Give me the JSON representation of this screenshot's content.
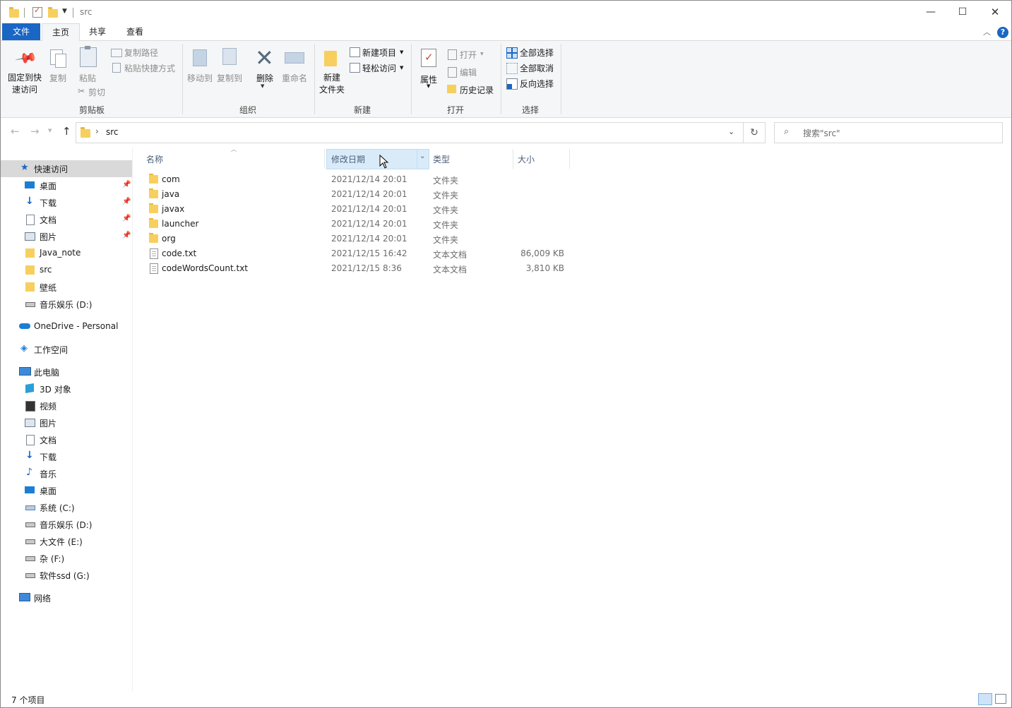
{
  "window": {
    "title": "src",
    "controls": {
      "minimize": "—",
      "maximize": "☐",
      "close": "✕"
    }
  },
  "ribbon_tabs": {
    "file": "文件",
    "home": "主页",
    "share": "共享",
    "view": "查看"
  },
  "ribbon": {
    "clipboard": {
      "pin": "固定到快\n速访问",
      "copy": "复制",
      "paste": "粘贴",
      "copy_path": "复制路径",
      "paste_shortcut": "粘贴快捷方式",
      "cut": "剪切",
      "label": "剪贴板"
    },
    "organize": {
      "move_to": "移动到",
      "copy_to": "复制到",
      "delete": "删除",
      "rename": "重命名",
      "label": "组织"
    },
    "new": {
      "new_folder": "新建\n文件夹",
      "new_item": "新建项目",
      "easy_access": "轻松访问",
      "label": "新建"
    },
    "open": {
      "properties": "属性",
      "open": "打开",
      "edit": "编辑",
      "history": "历史记录",
      "label": "打开"
    },
    "select": {
      "select_all": "全部选择",
      "select_none": "全部取消",
      "invert": "反向选择",
      "label": "选择"
    }
  },
  "address": {
    "crumb": "src",
    "refresh": "↻"
  },
  "search": {
    "placeholder": "搜索\"src\""
  },
  "nav": {
    "quick_access": "快速访问",
    "quick_items": [
      "桌面",
      "下载",
      "文档",
      "图片",
      "Java_note",
      "src",
      "壁纸",
      "音乐娱乐 (D:)"
    ],
    "onedrive": "OneDrive - Personal",
    "workspace": "工作空间",
    "this_pc": "此电脑",
    "pc_items": [
      "3D 对象",
      "视频",
      "图片",
      "文档",
      "下载",
      "音乐",
      "桌面",
      "系统 (C:)",
      "音乐娱乐 (D:)",
      "大文件 (E:)",
      "杂 (F:)",
      "软件ssd (G:)"
    ],
    "network": "网络"
  },
  "columns": {
    "name": "名称",
    "date": "修改日期",
    "type": "类型",
    "size": "大小"
  },
  "files": [
    {
      "name": "com",
      "date": "2021/12/14 20:01",
      "type": "文件夹",
      "size": "",
      "kind": "folder"
    },
    {
      "name": "java",
      "date": "2021/12/14 20:01",
      "type": "文件夹",
      "size": "",
      "kind": "folder"
    },
    {
      "name": "javax",
      "date": "2021/12/14 20:01",
      "type": "文件夹",
      "size": "",
      "kind": "folder"
    },
    {
      "name": "launcher",
      "date": "2021/12/14 20:01",
      "type": "文件夹",
      "size": "",
      "kind": "folder"
    },
    {
      "name": "org",
      "date": "2021/12/14 20:01",
      "type": "文件夹",
      "size": "",
      "kind": "folder"
    },
    {
      "name": "code.txt",
      "date": "2021/12/15 16:42",
      "type": "文本文档",
      "size": "86,009 KB",
      "kind": "file"
    },
    {
      "name": "codeWordsCount.txt",
      "date": "2021/12/15 8:36",
      "type": "文本文档",
      "size": "3,810 KB",
      "kind": "file"
    }
  ],
  "status": {
    "count": "7 个项目"
  },
  "colors": {
    "accent": "#1a66c4",
    "folder": "#f6cf5e",
    "selected_nav": "#d9d9d9",
    "hover_header": "#d9ebf9"
  }
}
